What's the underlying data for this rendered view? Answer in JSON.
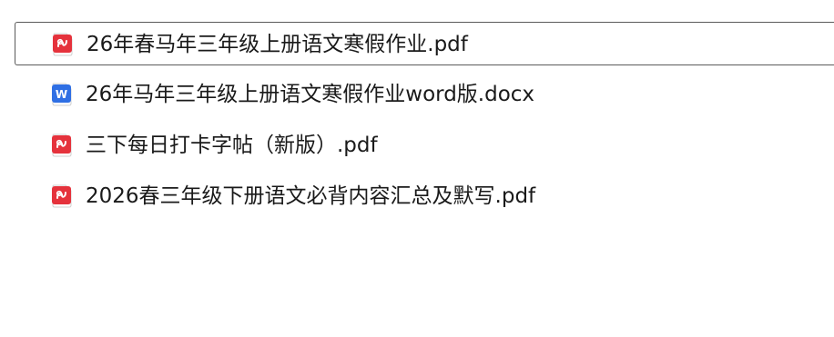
{
  "files": [
    {
      "name": "26年春马年三年级上册语文寒假作业.pdf",
      "icon": "pdf-icon",
      "color": "#e5323c",
      "selected": true
    },
    {
      "name": "26年马年三年级上册语文寒假作业word版.docx",
      "icon": "word-icon",
      "color": "#2f6fe4",
      "selected": false
    },
    {
      "name": "三下每日打卡字帖（新版）.pdf",
      "icon": "pdf-icon",
      "color": "#e5323c",
      "selected": false
    },
    {
      "name": "2026春三年级下册语文必背内容汇总及默写.pdf",
      "icon": "pdf-icon",
      "color": "#e5323c",
      "selected": false
    }
  ],
  "icons": {
    "word_letter": "W"
  },
  "colors": {
    "pdf": "#e5323c",
    "word": "#2f6fe4",
    "selection_border": "#5a5a5a"
  }
}
